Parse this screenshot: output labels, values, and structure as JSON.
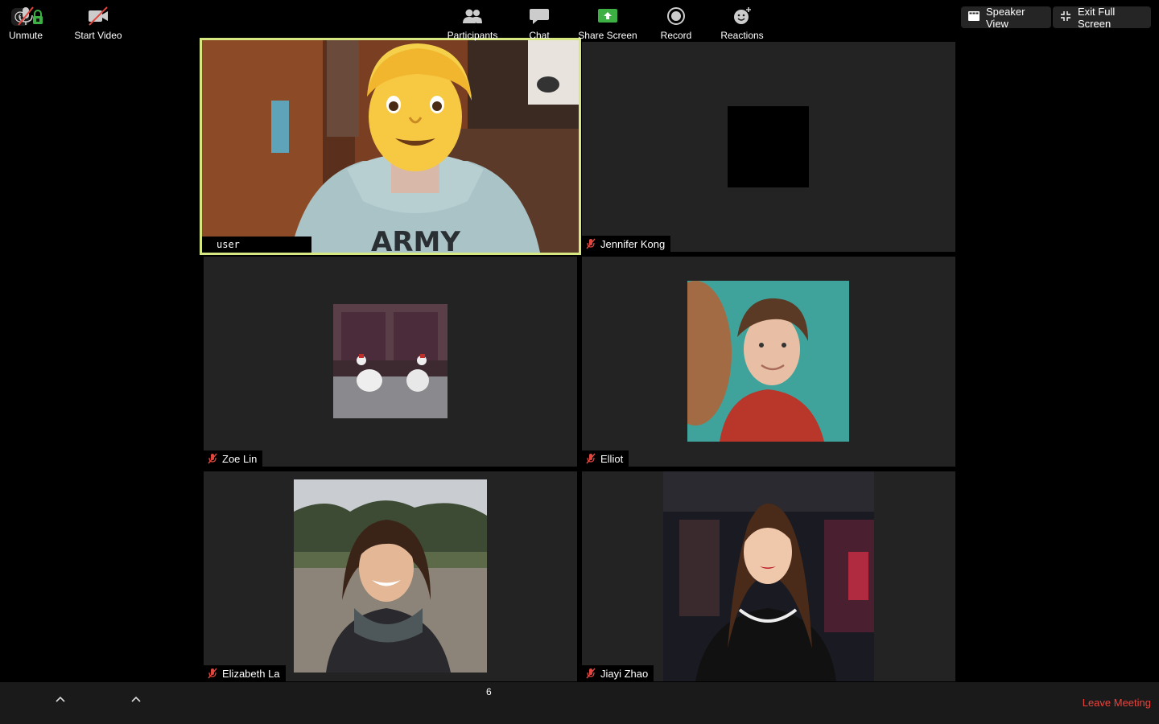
{
  "topbar": {
    "speaker_view_label": "Speaker View",
    "exit_fullscreen_label": "Exit Full Screen"
  },
  "participants": [
    {
      "name": "user",
      "muted": false,
      "video": "on",
      "active": true
    },
    {
      "name": "Jennifer Kong",
      "muted": true,
      "video": "off"
    },
    {
      "name": "Zoe Lin",
      "muted": true,
      "video": "photo"
    },
    {
      "name": "Elliot",
      "muted": true,
      "video": "photo"
    },
    {
      "name": "Elizabeth La",
      "muted": true,
      "video": "photo"
    },
    {
      "name": "Jiayi Zhao",
      "muted": true,
      "video": "photo"
    }
  ],
  "toolbar": {
    "unmute_label": "Unmute",
    "start_video_label": "Start Video",
    "participants_label": "Participants",
    "participants_count": "6",
    "chat_label": "Chat",
    "share_screen_label": "Share Screen",
    "record_label": "Record",
    "reactions_label": "Reactions",
    "leave_label": "Leave Meeting"
  },
  "colors": {
    "active_speaker_border": "#d7e883",
    "leave_red": "#e8443c",
    "share_green": "#3cb043",
    "mute_red": "#e0473f"
  },
  "icons": [
    "info-icon",
    "lock-icon",
    "speaker-view-icon",
    "exit-fullscreen-icon",
    "mic-muted-icon",
    "video-off-icon",
    "participants-icon",
    "chat-icon",
    "share-screen-icon",
    "record-icon",
    "reactions-icon"
  ]
}
